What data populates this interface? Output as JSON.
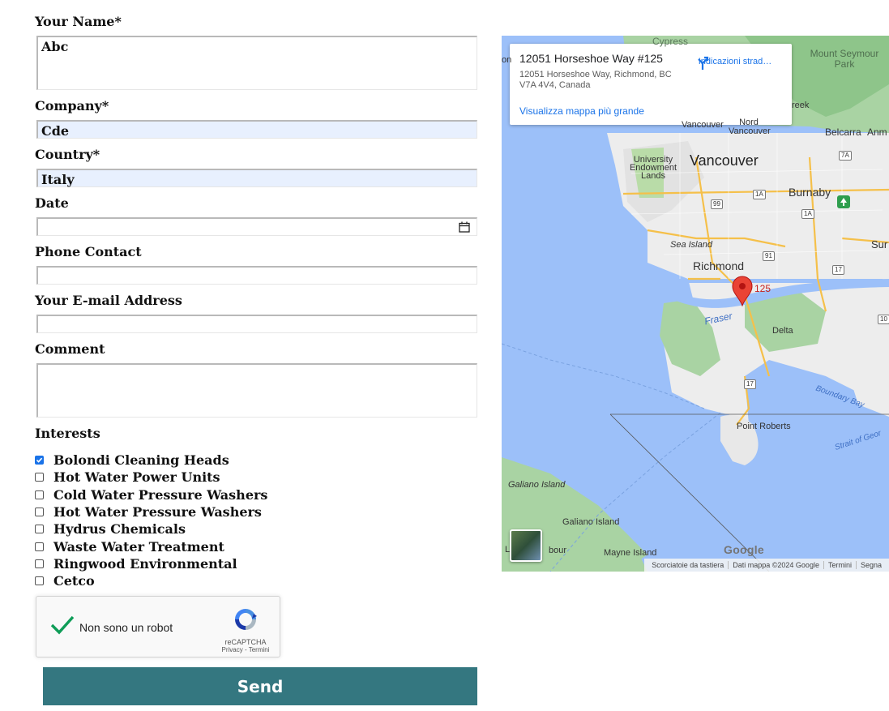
{
  "form": {
    "name_label": "Your Name*",
    "name_value": "Abc",
    "company_label": "Company*",
    "company_value": "Cde",
    "country_label": "Country*",
    "country_value": "Italy",
    "date_label": "Date",
    "date_value": "",
    "phone_label": "Phone Contact",
    "phone_value": "",
    "email_label": "Your E-mail Address",
    "email_value": "",
    "comment_label": "Comment",
    "comment_value": "",
    "interests_label": "Interests",
    "interests": [
      {
        "label": "Bolondi Cleaning Heads",
        "checked": true
      },
      {
        "label": "Hot Water Power Units",
        "checked": false
      },
      {
        "label": "Cold Water Pressure Washers",
        "checked": false
      },
      {
        "label": "Hot Water Pressure Washers",
        "checked": false
      },
      {
        "label": "Hydrus Chemicals",
        "checked": false
      },
      {
        "label": "Waste Water Treatment",
        "checked": false
      },
      {
        "label": "Ringwood Environmental",
        "checked": false
      },
      {
        "label": "Cetco",
        "checked": false
      }
    ],
    "send_label": "Send"
  },
  "recaptcha": {
    "label": "Non sono un robot",
    "brand": "reCAPTCHA",
    "privacy": "Privacy",
    "terms": "Termini",
    "checked": true
  },
  "map": {
    "place_title": "12051 Horseshoe Way #125",
    "place_address": "12051 Horseshoe Way, Richmond, BC V7A 4V4, Canada",
    "directions_label": "Indicazioni strad…",
    "larger_map_link": "Visualizza mappa più grande",
    "marker_label": "125",
    "labels": {
      "vancouver": "Vancouver",
      "burnaby": "Burnaby",
      "richmond": "Richmond",
      "delta": "Delta",
      "ube": "University Endowment Lands",
      "sea_island": "Sea Island",
      "point_roberts": "Point Roberts",
      "galiano_island_1": "Galiano Island",
      "galiano_island_2": "Galiano Island",
      "mayne_island": "Mayne Island",
      "mount_seymour": "Mount Seymour Park",
      "belcarra": "Belcarra",
      "anmore": "Anm",
      "north_vancouver": "Nord Vancouver",
      "vancouver_cut": "Vancouver",
      "cypress": "Cypress",
      "creek": "reek",
      "sur": "Sur",
      "fraser": "Fraser",
      "boundary_bay": "Boundary Bay",
      "strait": "Strait of Geor",
      "bour": "bour",
      "l": "L",
      "on": "on"
    },
    "highways": [
      "99",
      "1A",
      "1A",
      "91",
      "17",
      "17",
      "7A",
      "10"
    ],
    "footer": [
      "Scorciatoie da tastiera",
      "Dati mappa ©2024 Google",
      "Termini",
      "Segna"
    ],
    "google_logo": "Google"
  }
}
